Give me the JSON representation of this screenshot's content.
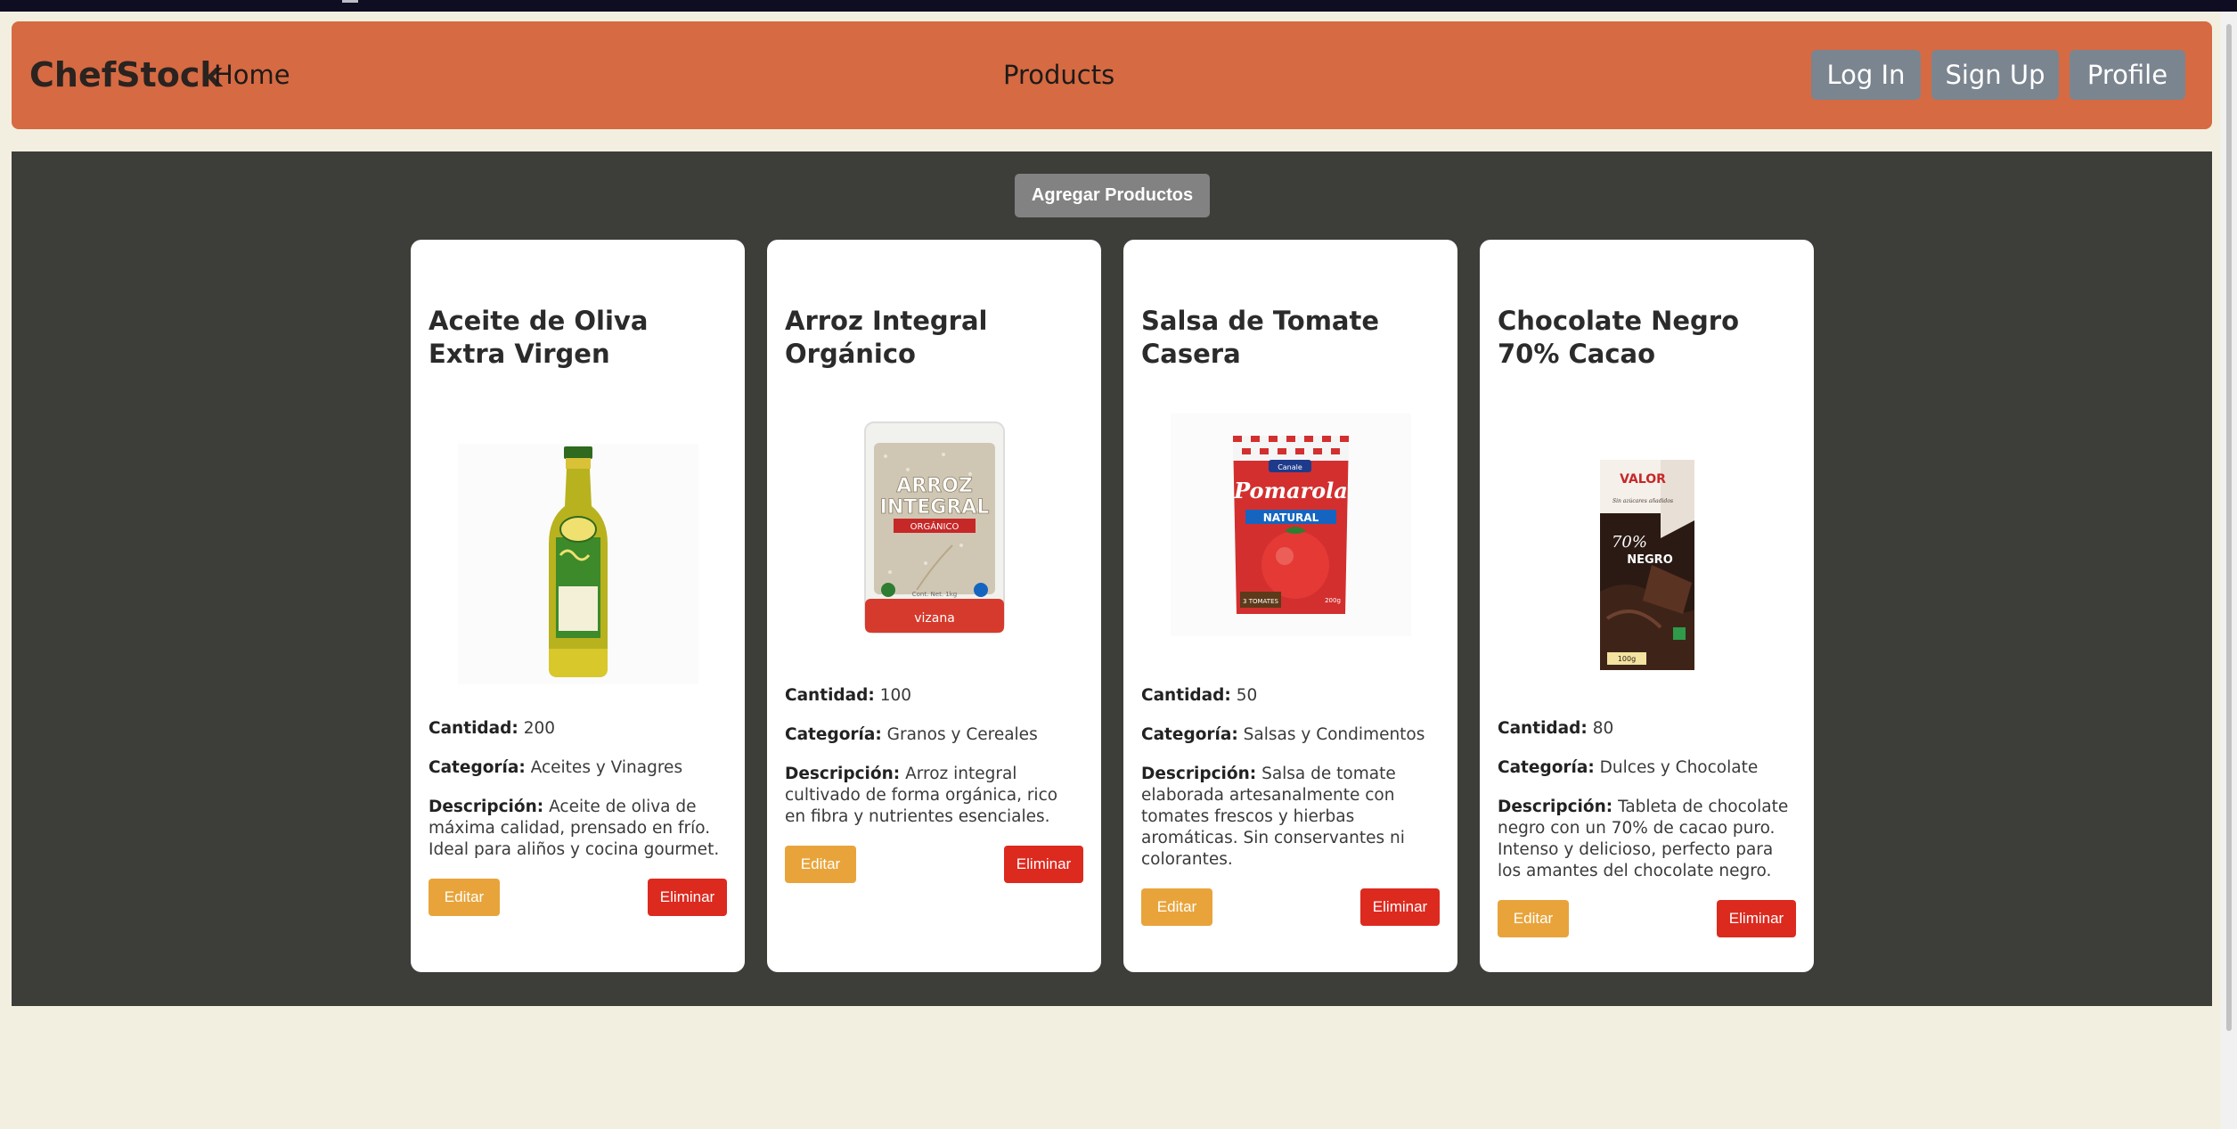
{
  "nav": {
    "brand": "ChefStock",
    "home": "Home",
    "products": "Products",
    "login": "Log In",
    "signup": "Sign Up",
    "profile": "Profile",
    "colors": {
      "navbar": "#d66a43",
      "nav_button": "#7b8590"
    }
  },
  "main": {
    "add_button": "Agregar Productos",
    "colors": {
      "background": "#3d3d3a",
      "edit": "#e8a43b",
      "delete": "#dc2a1f"
    }
  },
  "labels": {
    "quantity": "Cantidad:",
    "category": "Categoría:",
    "description": "Descripción:",
    "edit": "Editar",
    "delete": "Eliminar"
  },
  "products": [
    {
      "name": "Aceite de Oliva Extra Virgen",
      "quantity": "200",
      "category": "Aceites y Vinagres",
      "description": "Aceite de oliva de máxima calidad, prensado en frío. Ideal para aliños y cocina gourmet.",
      "image": "olive-oil-bottle"
    },
    {
      "name": "Arroz Integral Orgánico",
      "quantity": "100",
      "category": "Granos y Cereales",
      "description": "Arroz integral cultivado de forma orgánica, rico en fibra y nutrientes esenciales.",
      "image": "rice-bag",
      "package": {
        "line1": "ARROZ",
        "line2": "INTEGRAL",
        "band": "ORGÁNICO",
        "weight": "Cont. Net. 1kg",
        "brand": "vizana"
      }
    },
    {
      "name": "Salsa de Tomate Casera",
      "quantity": "50",
      "category": "Salsas y Condimentos",
      "description": "Salsa de tomate elaborada artesanalmente con tomates frescos y hierbas aromáticas. Sin conservantes ni colorantes.",
      "image": "tomato-sauce-pouch",
      "package": {
        "maker": "Canale",
        "brand": "Pomarola",
        "variant": "NATURAL",
        "count": "3 TOMATES",
        "weight": "200g"
      }
    },
    {
      "name": "Chocolate Negro 70% Cacao",
      "quantity": "80",
      "category": "Dulces y Chocolate",
      "description": "Tableta de chocolate negro con un 70% de cacao puro. Intenso y delicioso, perfecto para los amantes del chocolate negro.",
      "image": "dark-chocolate-bar",
      "package": {
        "brand": "VALOR",
        "tagline": "Sin azúcares añadidos",
        "percent": "70%",
        "kind": "NEGRO",
        "weight": "100g"
      }
    }
  ]
}
